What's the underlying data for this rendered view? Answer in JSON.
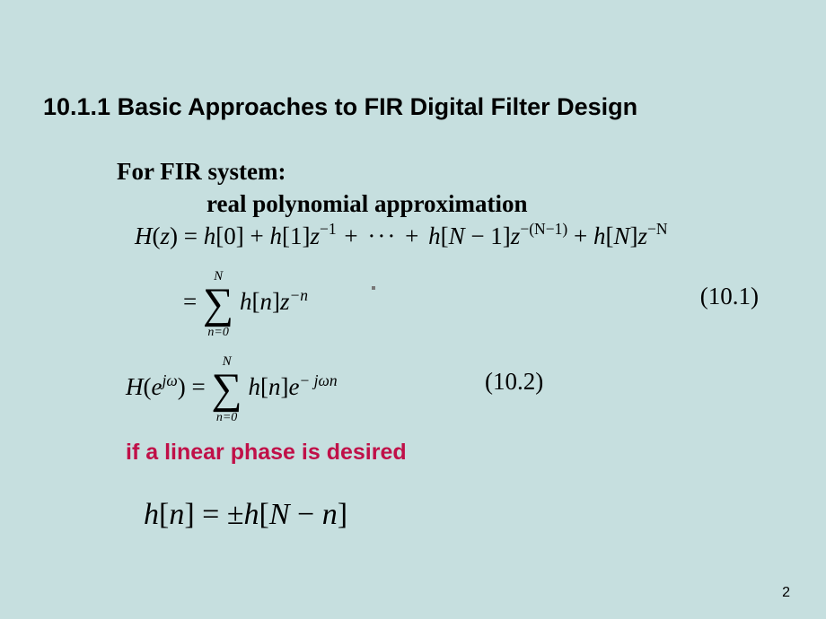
{
  "title": "10.1.1 Basic Approaches to FIR Digital Filter Design",
  "sub1": "For FIR system:",
  "sub2": "real polynomial approximation",
  "eq1": {
    "Hz": "H",
    "open": "(",
    "z": "z",
    "close": ")",
    "eq": " = ",
    "h": "h",
    "b0": "[0]",
    "plus": " + ",
    "b1": "[1]",
    "zm1": "−1",
    "dots": " + ··· + ",
    "bN1a": "[",
    "N": "N",
    "bN1b": " − 1]",
    "zmN1": "−(N−1)",
    "bNa": "[",
    "bNb": "]",
    "zmN": "−N"
  },
  "sumline": {
    "eq": " = ",
    "top": "N",
    "bot": "n=0",
    "h": "h",
    "bn": "[",
    "n": "n",
    "bn2": "]",
    "z": "z",
    "exp": "−n"
  },
  "eqnum1": "(10.1)",
  "eq2line": {
    "H": "H",
    "open": "(",
    "e": "e",
    "jw": "jω",
    "close": ")",
    "eq": " = ",
    "top": "N",
    "bot": "n=0",
    "h": "h",
    "bn": "[",
    "n": "n",
    "bn2": "]",
    "e2": "e",
    "exp": "− jωn"
  },
  "eqnum2": "(10.2)",
  "redtext": "if a linear phase is desired",
  "finaleq": {
    "h": "h",
    "bn": "[",
    "n": "n",
    "bn2": "]",
    "eq": " = ±",
    "h2": "h",
    "bN": "[",
    "N": "N",
    "minus": " − ",
    "n2": "n",
    "bN2": "]"
  },
  "page": "2"
}
